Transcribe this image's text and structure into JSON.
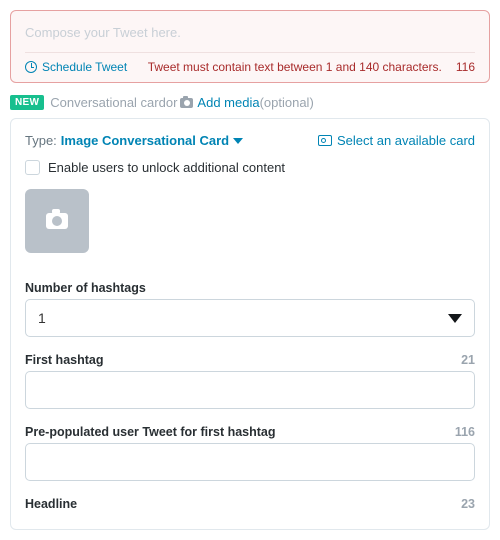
{
  "compose": {
    "placeholder": "Compose your Tweet here.",
    "schedule_label": "Schedule Tweet",
    "error": "Tweet must contain text between 1 and 140 characters.",
    "count": "116"
  },
  "subhead": {
    "new": "NEW",
    "conv_card": "Conversational card",
    "or": " or ",
    "add_media": "Add media",
    "optional": " (optional)"
  },
  "card": {
    "type_label": "Type: ",
    "type_value": "Image Conversational Card",
    "select_card": "Select an available card",
    "unlock_label": "Enable users to unlock additional content",
    "num_hashtags": {
      "label": "Number of hashtags",
      "value": "1"
    },
    "first_hashtag": {
      "label": "First hashtag",
      "count": "21",
      "value": ""
    },
    "prepop": {
      "label": "Pre-populated user Tweet for first hashtag",
      "count": "116",
      "value": ""
    },
    "headline": {
      "label": "Headline",
      "count": "23"
    }
  }
}
